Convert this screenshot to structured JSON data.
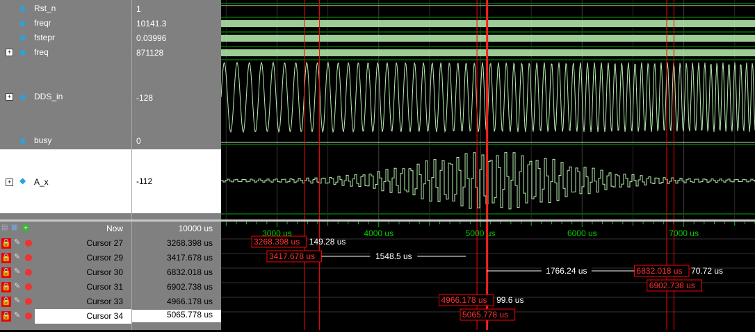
{
  "signals": [
    {
      "name": "Rst_n",
      "value": "1"
    },
    {
      "name": "freqr",
      "value": "10141.3"
    },
    {
      "name": "fstepr",
      "value": "0.03996"
    },
    {
      "name": "freq",
      "value": "871128",
      "expandable": true
    },
    {
      "name": "DDS_in",
      "value": "-128",
      "expandable": true
    },
    {
      "name": "busy",
      "value": "0"
    },
    {
      "name": "A_x",
      "value": "-112",
      "expandable": true,
      "selected": true
    }
  ],
  "now": {
    "label": "Now",
    "value": "10000 us"
  },
  "cursors": [
    {
      "name": "Cursor 27",
      "value": "3268.398 us",
      "t": 3268.398,
      "delta": "149.28 us"
    },
    {
      "name": "Cursor 29",
      "value": "3417.678 us",
      "t": 3417.678,
      "delta": "1548.5 us"
    },
    {
      "name": "Cursor 30",
      "value": "6832.018 us",
      "t": 6832.018,
      "delta": "1766.24 us"
    },
    {
      "name": "Cursor 31",
      "value": "6902.738 us",
      "t": 6902.738,
      "delta": "70.72 us"
    },
    {
      "name": "Cursor 33",
      "value": "4966.178 us",
      "t": 4966.178,
      "delta": "99.6 us"
    },
    {
      "name": "Cursor 34",
      "value": "5065.778 us",
      "t": 5065.778,
      "selected": true
    }
  ],
  "timeline": {
    "ticks": [
      "3000 us",
      "4000 us",
      "5000 us",
      "6000 us",
      "7000 us"
    ],
    "tick_values": [
      3000,
      4000,
      5000,
      6000,
      7000
    ],
    "visible_range_us": [
      2450,
      7700
    ]
  },
  "colors": {
    "wave": "#b8f0b0",
    "grid": "#00b000",
    "cursor": "#ff0000",
    "active_cursor": "#ff2020",
    "pane_bg": "#808080"
  },
  "icons": [
    "lock-icon",
    "wrench-icon",
    "remove-icon",
    "add-cursor-icon"
  ]
}
